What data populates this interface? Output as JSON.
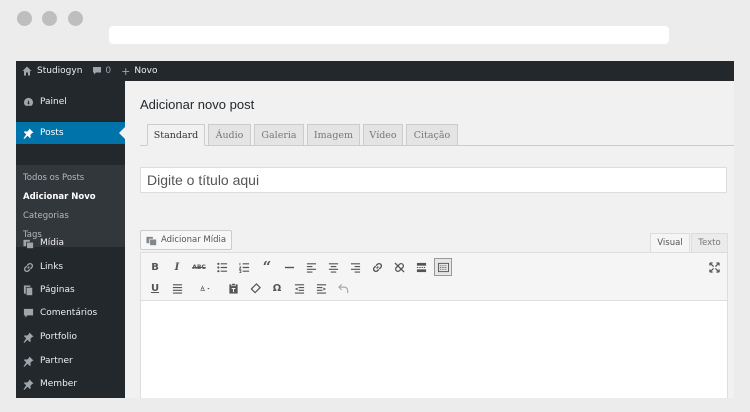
{
  "adminbar": {
    "site_name": "Studiogyn",
    "comments_count": "0",
    "new_label": "Novo"
  },
  "sidebar": {
    "items": [
      {
        "label": "Painel",
        "icon": "dashboard-icon"
      },
      {
        "label": "Posts",
        "icon": "pin-icon",
        "active": true
      },
      {
        "label": "Mídia",
        "icon": "media-icon"
      },
      {
        "label": "Links",
        "icon": "link-icon"
      },
      {
        "label": "Páginas",
        "icon": "pages-icon"
      },
      {
        "label": "Comentários",
        "icon": "comment-icon"
      },
      {
        "label": "Portfolio",
        "icon": "pin-icon"
      },
      {
        "label": "Partner",
        "icon": "pin-icon"
      },
      {
        "label": "Member",
        "icon": "pin-icon"
      }
    ],
    "submenu": [
      {
        "label": "Todos os Posts"
      },
      {
        "label": "Adicionar Novo",
        "current": true
      },
      {
        "label": "Categorias"
      },
      {
        "label": "Tags"
      }
    ]
  },
  "main": {
    "page_title": "Adicionar novo post",
    "post_formats": [
      "Standard",
      "Áudio",
      "Galeria",
      "Imagem",
      "Vídeo",
      "Citação"
    ],
    "active_format": "Standard",
    "title_placeholder": "Digite o título aqui",
    "add_media_label": "Adicionar Mídia",
    "editor_tabs": {
      "visual": "Visual",
      "text": "Texto"
    },
    "toolbar_row1": [
      "bold-icon",
      "italic-icon",
      "strikethrough-icon",
      "bullet-list-icon",
      "numbered-list-icon",
      "blockquote-icon",
      "horizontal-line-icon",
      "align-left-icon",
      "align-center-icon",
      "align-right-icon",
      "insert-link-icon",
      "remove-link-icon",
      "read-more-icon",
      "toolbar-toggle-icon",
      "fullscreen-icon"
    ],
    "toolbar_row2": [
      "underline-icon",
      "justify-icon",
      "text-color-icon",
      "paste-text-icon",
      "clear-format-icon",
      "special-char-icon",
      "outdent-icon",
      "indent-icon",
      "undo-icon"
    ]
  },
  "colors": {
    "adminbar_bg": "#23282d",
    "sidebar_bg": "#23282d",
    "active_menu": "#0073aa",
    "page_bg": "#f1f1f1"
  }
}
